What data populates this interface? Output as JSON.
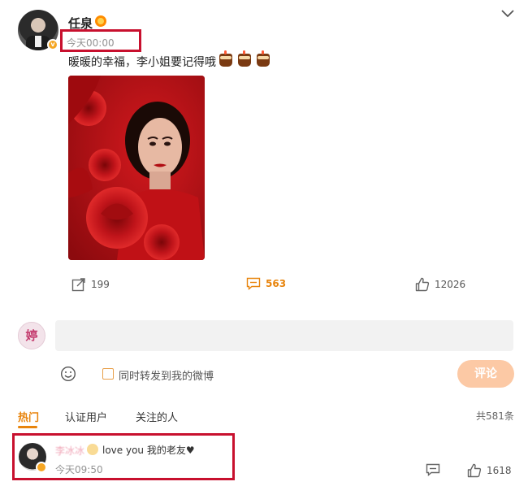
{
  "post": {
    "username": "任泉",
    "time": "今天00:00",
    "text": "暖暖的幸福，李小姐要记得哦",
    "cake_icons": [
      "cake-icon",
      "cake-icon",
      "cake-icon"
    ],
    "image_alt": "portrait-with-red-roses"
  },
  "actions": {
    "repost_count": "199",
    "comment_count": "563",
    "like_count": "12026"
  },
  "compose": {
    "placeholder": "",
    "repost_label": "同时转发到我的微博",
    "submit_label": "评论"
  },
  "tabs": [
    {
      "label": "热门",
      "active": true
    },
    {
      "label": "认证用户",
      "active": false
    },
    {
      "label": "关注的人",
      "active": false
    }
  ],
  "total_comments": "共581条",
  "comment": {
    "username": "李冰冰",
    "text": "love you 我的老友♥",
    "time": "今天09:50",
    "like_count": "1618"
  },
  "colors": {
    "accent": "#e8840c",
    "highlight_box": "#c8102e",
    "submit_bg": "#fcc9a5",
    "input_bg": "#f2f2f2"
  }
}
